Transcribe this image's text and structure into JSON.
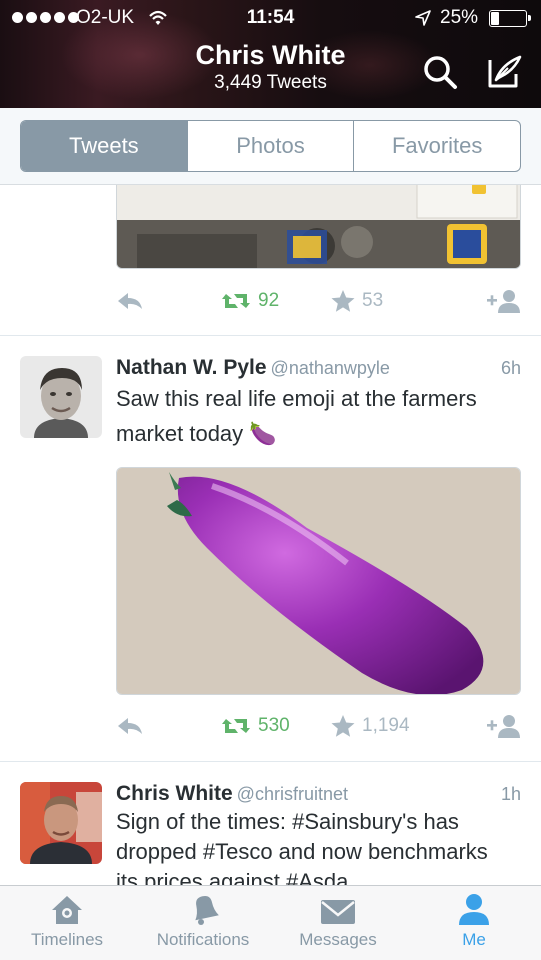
{
  "status_bar": {
    "carrier": "O2-UK",
    "time": "11:54",
    "battery": "25%",
    "battery_level": 0.25
  },
  "header": {
    "name": "Chris White",
    "tweet_count": "3,449 Tweets"
  },
  "tabs_segment": [
    {
      "label": "Tweets",
      "active": true
    },
    {
      "label": "Photos",
      "active": false
    },
    {
      "label": "Favorites",
      "active": false
    }
  ],
  "tweets": [
    {
      "retweets": "92",
      "favorites": "53"
    },
    {
      "name": "Nathan W. Pyle",
      "handle": "@nathanwpyle",
      "time": "6h",
      "text": "Saw this real life emoji at the farmers market today 🍆",
      "retweets": "530",
      "favorites": "1,194"
    },
    {
      "name": "Chris White",
      "handle": "@chrisfruitnet",
      "time": "1h",
      "text": "Sign of the times: #Sainsbury's has dropped #Tesco and now benchmarks its prices against #Asda"
    }
  ],
  "tabbar": [
    {
      "label": "Timelines",
      "icon": "home-icon"
    },
    {
      "label": "Notifications",
      "icon": "bell-icon"
    },
    {
      "label": "Messages",
      "icon": "envelope-icon"
    },
    {
      "label": "Me",
      "icon": "person-icon",
      "active": true
    }
  ],
  "colors": {
    "accent": "#3ba1e8",
    "retweet": "#5fb36a",
    "muted": "#8899a6"
  }
}
